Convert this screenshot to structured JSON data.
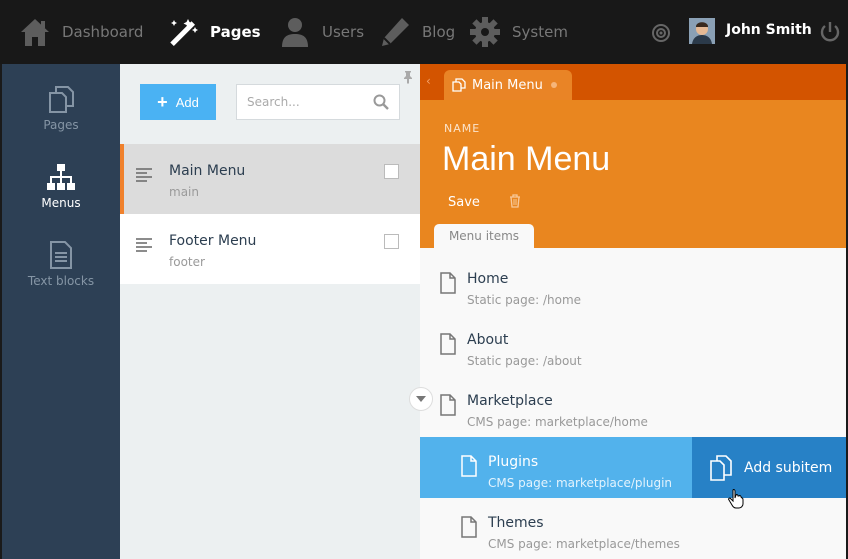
{
  "nav": {
    "dashboard": "Dashboard",
    "pages": "Pages",
    "users": "Users",
    "blog": "Blog",
    "system": "System",
    "user_name": "John Smith"
  },
  "sidebar": {
    "items": [
      {
        "label": "Pages",
        "icon": "pages-icon"
      },
      {
        "label": "Menus",
        "icon": "sitemap-icon"
      },
      {
        "label": "Text blocks",
        "icon": "document-icon"
      }
    ]
  },
  "list": {
    "add_label": "Add",
    "search_placeholder": "Search...",
    "items": [
      {
        "title": "Main Menu",
        "code": "main"
      },
      {
        "title": "Footer Menu",
        "code": "footer"
      }
    ]
  },
  "editor": {
    "tab_label": "Main Menu",
    "name_label": "NAME",
    "name_value": "Main Menu",
    "save_label": "Save",
    "inner_tab": "Menu items",
    "add_subitem": "Add subitem",
    "items": [
      {
        "title": "Home",
        "sub": "Static page: /home"
      },
      {
        "title": "About",
        "sub": "Static page: /about"
      },
      {
        "title": "Marketplace",
        "sub": "CMS page: marketplace/home"
      },
      {
        "title": "Plugins",
        "sub": "CMS page: marketplace/plugin"
      },
      {
        "title": "Themes",
        "sub": "CMS page: marketplace/themes"
      }
    ]
  },
  "colors": {
    "accent_orange": "#e9861f",
    "tab_strip": "#d35400",
    "highlight_blue": "#52b2ec",
    "action_blue": "#2781c6",
    "sidebar_bg": "#2d4055"
  }
}
